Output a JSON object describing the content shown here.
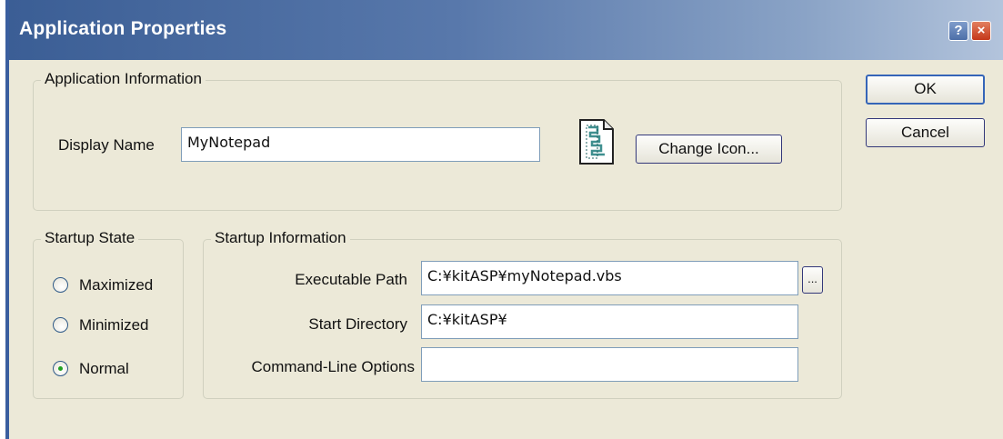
{
  "window": {
    "title": "Application Properties",
    "help_label": "?",
    "close_label": "×"
  },
  "app_info": {
    "group_label": "Application Information",
    "display_name_label": "Display Name",
    "display_name_value": "MyNotepad",
    "icon_name": "script-file-icon",
    "change_icon_label": "Change Icon..."
  },
  "startup_state": {
    "group_label": "Startup State",
    "options": [
      {
        "label": "Maximized",
        "selected": false
      },
      {
        "label": "Minimized",
        "selected": false
      },
      {
        "label": "Normal",
        "selected": true
      }
    ]
  },
  "startup_info": {
    "group_label": "Startup Information",
    "executable_path_label": "Executable Path",
    "executable_path_value": "C:¥kitASP¥myNotepad.vbs",
    "browse_label": "...",
    "start_directory_label": "Start Directory",
    "start_directory_value": "C:¥kitASP¥",
    "command_line_label": "Command-Line Options",
    "command_line_value": ""
  },
  "buttons": {
    "ok_label": "OK",
    "cancel_label": "Cancel"
  },
  "colors": {
    "titlebar_start": "#3b5e95",
    "dialog_background": "#ece9d8",
    "close_button": "#c5381a"
  }
}
